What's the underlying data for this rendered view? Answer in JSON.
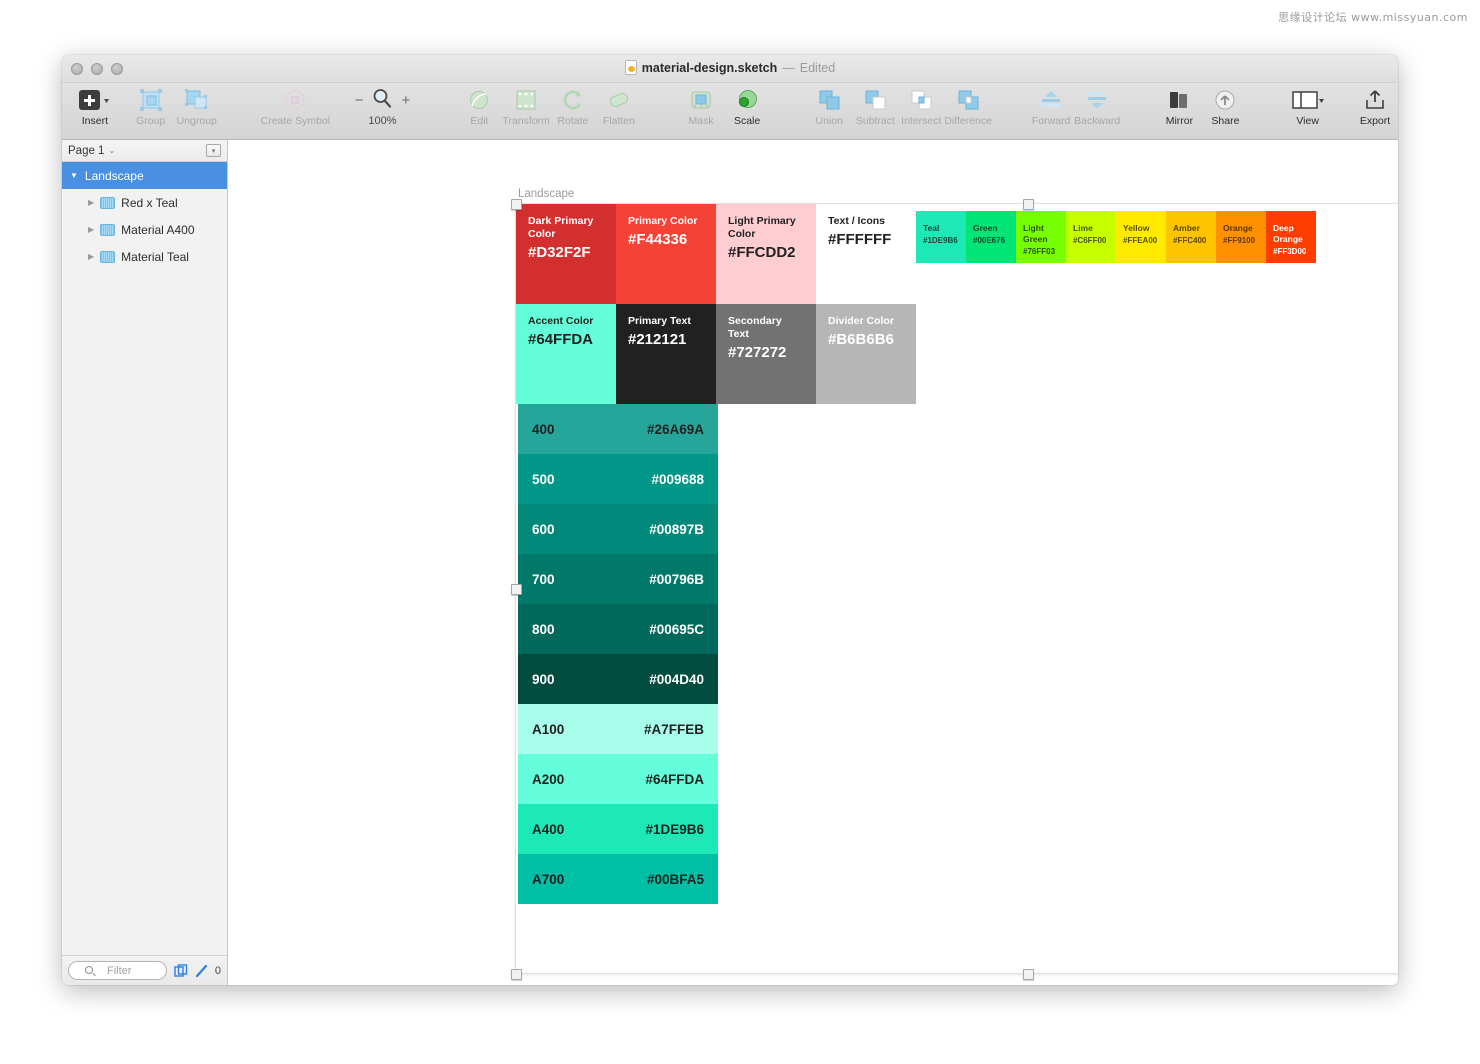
{
  "watermark": "思缘设计论坛 www.missyuan.com",
  "titlebar": {
    "file_icon": "sketch-file-icon",
    "filename": "material-design.sketch",
    "separator": "—",
    "status": "Edited"
  },
  "toolbar": {
    "zoom_out": "−",
    "zoom_in": "+",
    "zoom_level": "100%",
    "items": [
      {
        "label": "Insert",
        "icon": "plus-square-icon",
        "state": "strong"
      },
      {
        "label": "Group",
        "icon": "group-icon",
        "state": "dim"
      },
      {
        "label": "Ungroup",
        "icon": "ungroup-icon",
        "state": "dim"
      },
      {
        "label": "Create Symbol",
        "icon": "create-symbol-icon",
        "state": "dim"
      },
      {
        "label": "Edit",
        "icon": "edit-icon",
        "state": "dim"
      },
      {
        "label": "Transform",
        "icon": "transform-icon",
        "state": "dim"
      },
      {
        "label": "Rotate",
        "icon": "rotate-icon",
        "state": "dim"
      },
      {
        "label": "Flatten",
        "icon": "flatten-icon",
        "state": "dim"
      },
      {
        "label": "Mask",
        "icon": "mask-icon",
        "state": "dim"
      },
      {
        "label": "Scale",
        "icon": "scale-icon",
        "state": "strong"
      },
      {
        "label": "Union",
        "icon": "union-icon",
        "state": "dim"
      },
      {
        "label": "Subtract",
        "icon": "subtract-icon",
        "state": "dim"
      },
      {
        "label": "Intersect",
        "icon": "intersect-icon",
        "state": "dim"
      },
      {
        "label": "Difference",
        "icon": "difference-icon",
        "state": "dim"
      },
      {
        "label": "Forward",
        "icon": "forward-icon",
        "state": "dim"
      },
      {
        "label": "Backward",
        "icon": "backward-icon",
        "state": "dim"
      },
      {
        "label": "Mirror",
        "icon": "mirror-icon",
        "state": "strong"
      },
      {
        "label": "Share",
        "icon": "share-cloud-icon",
        "state": "strong"
      },
      {
        "label": "View",
        "icon": "view-layout-icon",
        "state": "strong"
      },
      {
        "label": "Export",
        "icon": "export-icon",
        "state": "strong"
      }
    ]
  },
  "sidebar": {
    "page_name": "Page 1",
    "page_caret": "⌄",
    "options_icon": "filter-options-icon",
    "layers": [
      {
        "label": "Landscape",
        "type": "artboard",
        "selected": true,
        "disclosure": "▼"
      },
      {
        "label": "Red x Teal",
        "type": "group",
        "selected": false,
        "disclosure": "▶"
      },
      {
        "label": "Material A400",
        "type": "group",
        "selected": false,
        "disclosure": "▶"
      },
      {
        "label": "Material Teal",
        "type": "group",
        "selected": false,
        "disclosure": "▶"
      }
    ],
    "filter_placeholder": "Filter",
    "count": "0",
    "icons": {
      "search": "search-icon",
      "copy": "duplicate-icon",
      "pen": "pen-icon"
    }
  },
  "canvas": {
    "artboard_label": "Landscape",
    "primary_row": [
      {
        "name": "Dark Primary Color",
        "hex": "#D32F2F",
        "bg": "#D32F2F",
        "fg": "#FFFFFF"
      },
      {
        "name": "Primary Color",
        "hex": "#F44336",
        "bg": "#F44336",
        "fg": "#FFFFFF"
      },
      {
        "name": "Light Primary Color",
        "hex": "#FFCDD2",
        "bg": "#FFCDD2",
        "fg": "#212121"
      },
      {
        "name": "Text / Icons",
        "hex": "#FFFFFF",
        "bg": "#FFFFFF",
        "fg": "#212121"
      }
    ],
    "accent_strip": [
      {
        "name": "Teal",
        "hex": "#1DE9B6",
        "bg": "#1DE9B6",
        "fg": "#124b3d"
      },
      {
        "name": "Green",
        "hex": "#00E676",
        "bg": "#00E676",
        "fg": "#0d4a2a"
      },
      {
        "name": "Light Green",
        "hex": "#76FF03",
        "bg": "#76FF03",
        "fg": "#2a5402"
      },
      {
        "name": "Lime",
        "hex": "#C6FF00",
        "bg": "#C6FF00",
        "fg": "#4a5602"
      },
      {
        "name": "Yellow",
        "hex": "#FFEA00",
        "bg": "#FFEA00",
        "fg": "#5a5200"
      },
      {
        "name": "Amber",
        "hex": "#FFC400",
        "bg": "#FFC400",
        "fg": "#5a4500"
      },
      {
        "name": "Orange",
        "hex": "#FF9100",
        "bg": "#FF9100",
        "fg": "#5e3500"
      },
      {
        "name": "Deep Orange",
        "hex": "#FF3D00",
        "bg": "#FF3D00",
        "fg": "#FFFFFF"
      }
    ],
    "secondary_row": [
      {
        "name": "Accent Color",
        "hex": "#64FFDA",
        "bg": "#64FFDA",
        "fg": "#212121"
      },
      {
        "name": "Primary Text",
        "hex": "#212121",
        "bg": "#212121",
        "fg": "#FFFFFF"
      },
      {
        "name": "Secondary Text",
        "hex": "#727272",
        "bg": "#727272",
        "fg": "#FFFFFF"
      },
      {
        "name": "Divider Color",
        "hex": "#B6B6B6",
        "bg": "#B6B6B6",
        "fg": "#FFFFFF"
      }
    ],
    "teal_scale": [
      {
        "step": "400",
        "hex": "#26A69A",
        "bg": "#26A69A",
        "fg": "#212121"
      },
      {
        "step": "500",
        "hex": "#009688",
        "bg": "#009688",
        "fg": "#FFFFFF"
      },
      {
        "step": "600",
        "hex": "#00897B",
        "bg": "#00897B",
        "fg": "#FFFFFF"
      },
      {
        "step": "700",
        "hex": "#00796B",
        "bg": "#00796B",
        "fg": "#FFFFFF"
      },
      {
        "step": "800",
        "hex": "#00695C",
        "bg": "#00695C",
        "fg": "#FFFFFF"
      },
      {
        "step": "900",
        "hex": "#004D40",
        "bg": "#004D40",
        "fg": "#FFFFFF"
      },
      {
        "step": "A100",
        "hex": "#A7FFEB",
        "bg": "#A7FFEB",
        "fg": "#212121"
      },
      {
        "step": "A200",
        "hex": "#64FFDA",
        "bg": "#64FFDA",
        "fg": "#212121"
      },
      {
        "step": "A400",
        "hex": "#1DE9B6",
        "bg": "#1DE9B6",
        "fg": "#212121"
      },
      {
        "step": "A700",
        "hex": "#00BFA5",
        "bg": "#00BFA5",
        "fg": "#212121"
      }
    ]
  }
}
